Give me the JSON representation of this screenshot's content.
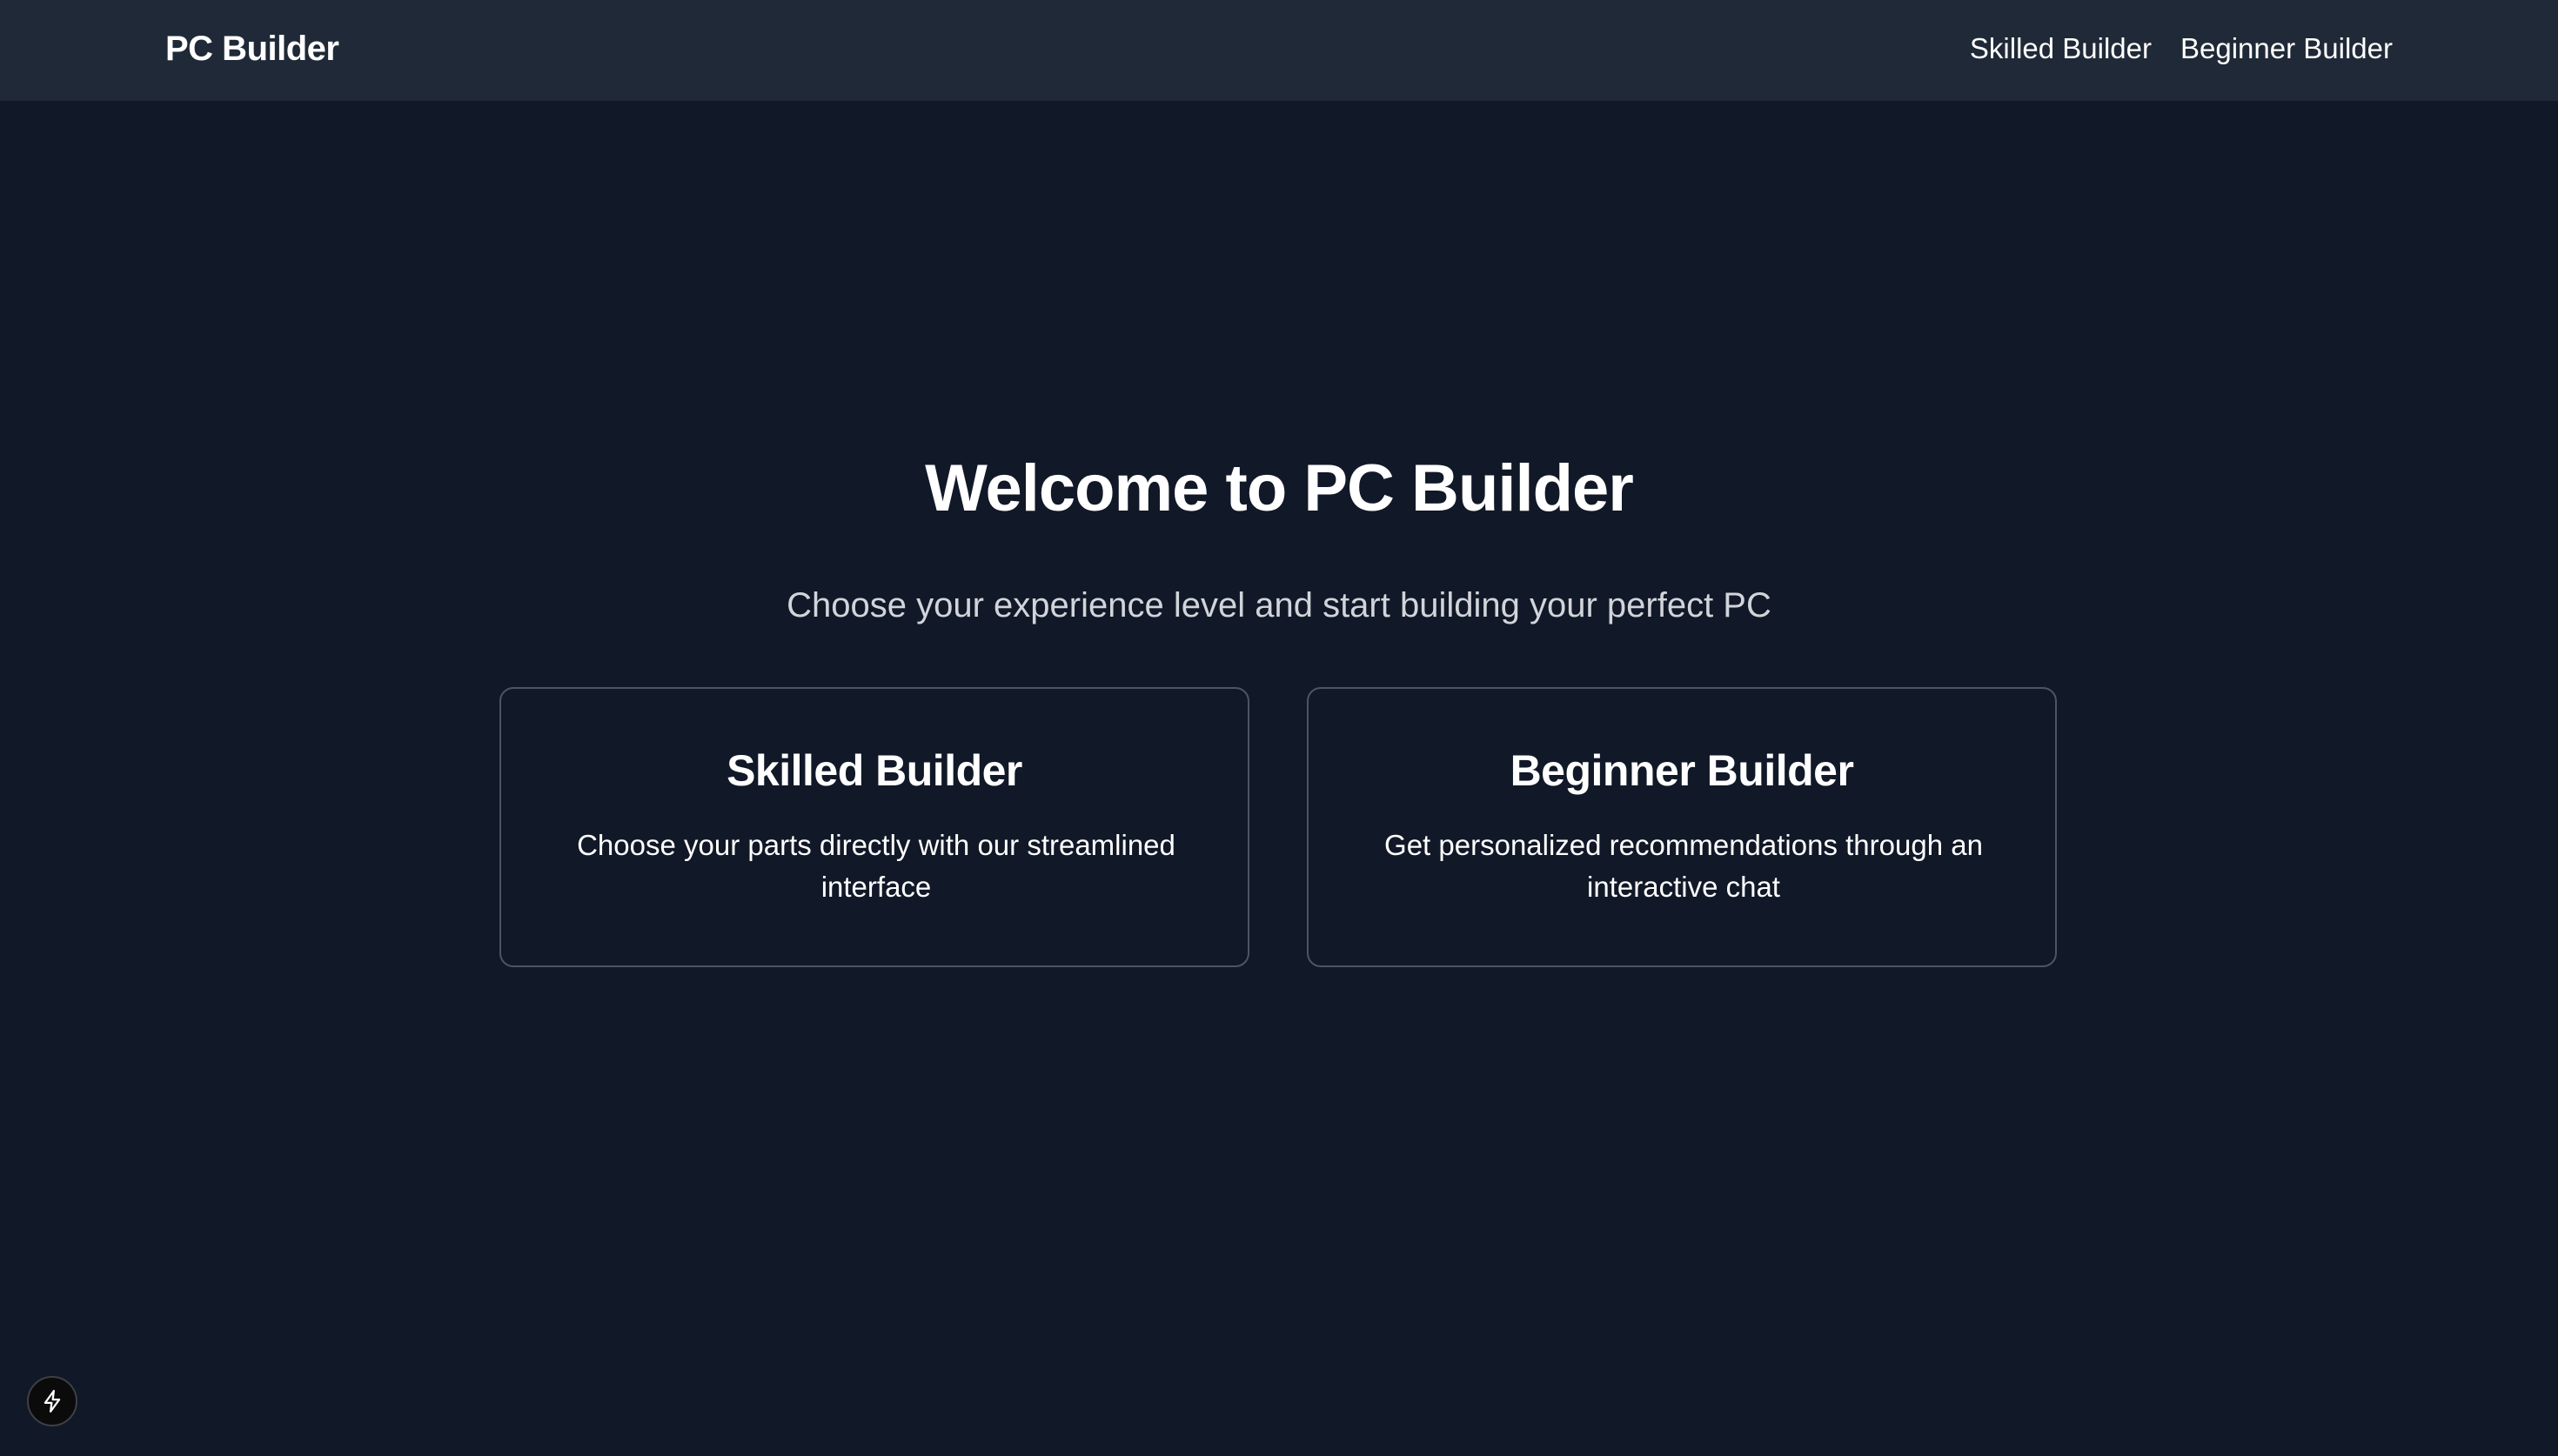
{
  "navbar": {
    "brand": "PC Builder",
    "links": [
      {
        "label": "Skilled Builder"
      },
      {
        "label": "Beginner Builder"
      }
    ]
  },
  "hero": {
    "title": "Welcome to PC Builder",
    "subtitle": "Choose your experience level and start building your perfect PC"
  },
  "cards": [
    {
      "title": "Skilled Builder",
      "description": "Choose your parts directly with our streamlined interface"
    },
    {
      "title": "Beginner Builder",
      "description": "Get personalized recommendations through an interactive chat"
    }
  ],
  "dev_indicator": {
    "icon": "lightning-bolt-icon"
  },
  "colors": {
    "background": "#111827",
    "navbar": "#1f2937",
    "card_border": "#4b5563",
    "subtitle_text": "#d1d5db",
    "text": "#ffffff"
  }
}
